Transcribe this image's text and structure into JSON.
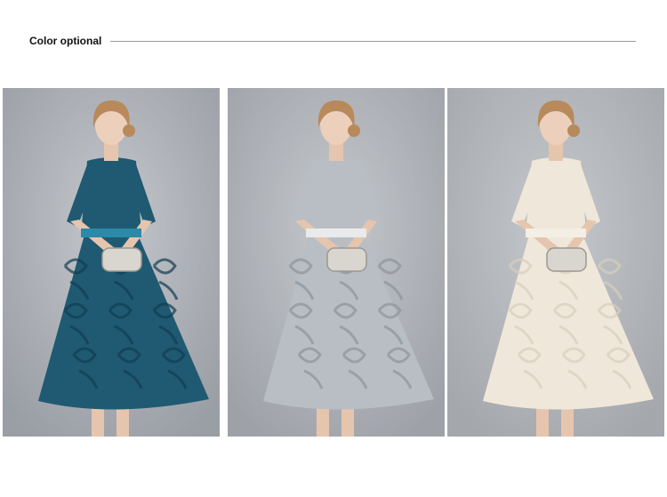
{
  "header": {
    "title": "Color optional"
  },
  "gallery": {
    "items": [
      {
        "name": "teal-lace-dress-photo",
        "dress_color": "#1f5a72",
        "dress_dark": "#123d52",
        "belt_color": "#2a8aa8",
        "background": "#9a9ea5"
      },
      {
        "name": "silver-lace-dress-photo",
        "dress_color": "#b9bec4",
        "dress_dark": "#8e949b",
        "belt_color": "#e8eaec",
        "background": "#9ea2a8"
      },
      {
        "name": "cream-lace-dress-photo",
        "dress_color": "#efe8da",
        "dress_dark": "#d8cfbd",
        "belt_color": "#f4efe5",
        "background": "#a4a7ab"
      }
    ]
  }
}
